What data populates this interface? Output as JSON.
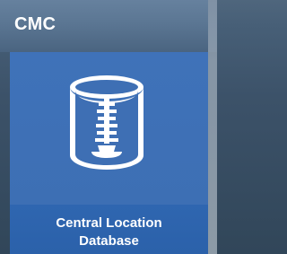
{
  "app": {
    "section_title": "CMC"
  },
  "tile": {
    "label": "Central Location\nDatabase",
    "icon": "database-icon"
  }
}
